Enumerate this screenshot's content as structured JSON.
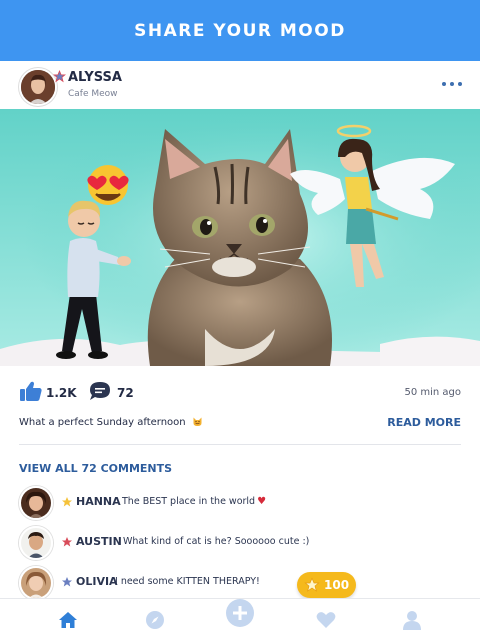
{
  "header": {
    "title": "SHARE YOUR MOOD"
  },
  "post": {
    "author": {
      "name": "ALYSSA",
      "location": "Cafe Meow"
    },
    "likes": "1.2K",
    "comments_count": "72",
    "time": "50 min ago",
    "caption": "What a perfect Sunday afternoon",
    "read_more": "READ MORE",
    "view_all": "VIEW ALL 72 COMMENTS"
  },
  "comments": [
    {
      "name": "HANNA",
      "text": "The BEST place in the world",
      "star": "gold",
      "heart": true
    },
    {
      "name": "AUSTIN",
      "text": "What kind of cat is he? Soooooo cute :)",
      "star": "red",
      "heart": false
    },
    {
      "name": "OLIVIA",
      "text": "I need some KITTEN THERAPY!",
      "star": "blue",
      "heart": false
    }
  ],
  "badge": {
    "count": "100"
  },
  "tabs": [
    "home-icon",
    "compass-icon",
    "plus-icon",
    "heart-icon",
    "profile-icon"
  ],
  "colors": {
    "header": "#3e95f1",
    "link": "#2d5c9c",
    "badge": "#f5b91c",
    "photo_bg": "#6fd6cc"
  }
}
